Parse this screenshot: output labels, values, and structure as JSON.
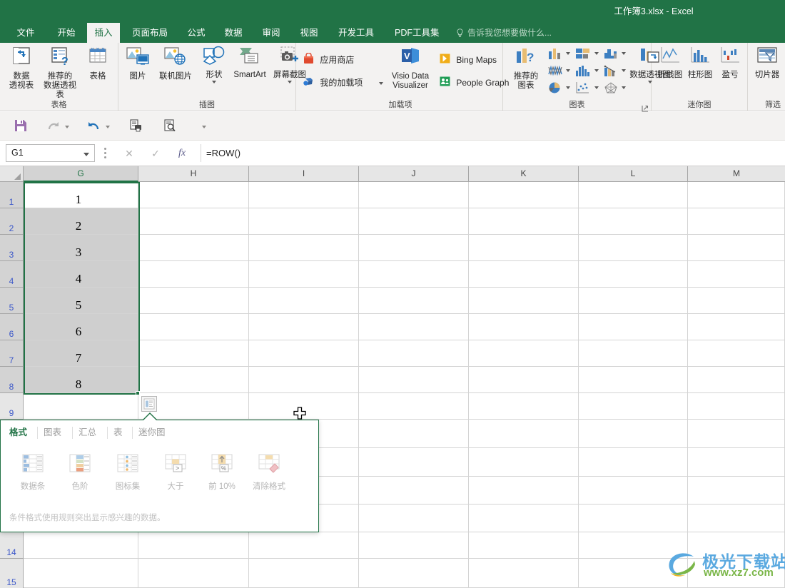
{
  "window": {
    "title": "工作簿3.xlsx - Excel"
  },
  "ribbon": {
    "tabs": [
      {
        "label": "文件",
        "active": false
      },
      {
        "label": "开始",
        "active": false
      },
      {
        "label": "插入",
        "active": true
      },
      {
        "label": "页面布局",
        "active": false
      },
      {
        "label": "公式",
        "active": false
      },
      {
        "label": "数据",
        "active": false
      },
      {
        "label": "审阅",
        "active": false
      },
      {
        "label": "视图",
        "active": false
      },
      {
        "label": "开发工具",
        "active": false
      },
      {
        "label": "PDF工具集",
        "active": false
      }
    ],
    "tell_me": "告诉我您想要做什么...",
    "groups": [
      {
        "name": "表格",
        "big_buttons": [
          {
            "label": "数据\n透视表",
            "icon": "pivot-table-icon"
          },
          {
            "label": "推荐的\n数据透视表",
            "icon": "recommended-pivot-table-icon"
          },
          {
            "label": "表格",
            "icon": "table-icon"
          }
        ]
      },
      {
        "name": "插图",
        "big_buttons": [
          {
            "label": "图片",
            "icon": "picture-icon"
          },
          {
            "label": "联机图片",
            "icon": "online-picture-icon"
          },
          {
            "label": "形状",
            "icon": "shapes-icon"
          },
          {
            "label": "SmartArt",
            "icon": "smartart-icon"
          },
          {
            "label": "屏幕截图",
            "icon": "screenshot-icon"
          }
        ]
      },
      {
        "name": "加载项",
        "small_buttons": [
          {
            "label": "应用商店",
            "icon": "store-icon"
          },
          {
            "label": "我的加载项",
            "icon": "my-addins-icon"
          },
          {
            "label": "Bing Maps",
            "icon": "bing-maps-icon"
          },
          {
            "label": "People Graph",
            "icon": "people-graph-icon"
          }
        ],
        "big_buttons": [
          {
            "label": "Visio Data\nVisualizer",
            "icon": "visio-data-visualizer-icon"
          }
        ]
      },
      {
        "name": "图表",
        "big_buttons": [
          {
            "label": "推荐的\n图表",
            "icon": "recommended-charts-icon"
          },
          {
            "label": "数据透视图",
            "icon": "pivot-chart-icon"
          }
        ],
        "mini_charts": [
          {
            "name": "column-chart-icon"
          },
          {
            "name": "bar-chart-icon"
          },
          {
            "name": "line-area-chart-icon"
          },
          {
            "name": "stock-chart-icon"
          },
          {
            "name": "histogram-chart-icon"
          },
          {
            "name": "waterfall-chart-icon"
          },
          {
            "name": "pie-chart-icon"
          },
          {
            "name": "scatter-chart-icon"
          },
          {
            "name": "radar-chart-icon"
          }
        ]
      },
      {
        "name": "迷你图",
        "big_buttons": [
          {
            "label": "折线图",
            "icon": "sparkline-line-icon"
          },
          {
            "label": "柱形图",
            "icon": "sparkline-column-icon"
          },
          {
            "label": "盈亏",
            "icon": "sparkline-winloss-icon"
          }
        ]
      },
      {
        "name": "筛选",
        "big_buttons": [
          {
            "label": "切片器",
            "icon": "slicer-icon"
          }
        ]
      }
    ]
  },
  "quick_access": {
    "buttons": [
      {
        "name": "save-icon"
      },
      {
        "name": "redo-icon"
      },
      {
        "name": "undo-icon"
      },
      {
        "name": "print-preview-icon"
      },
      {
        "name": "print-preview-and-print-icon"
      },
      {
        "name": "customize-qat-icon"
      }
    ]
  },
  "formula_bar": {
    "name_box_value": "G1",
    "cancel_label": "✕",
    "confirm_label": "✓",
    "fx_label": "fx",
    "formula_value": "=ROW()"
  },
  "grid": {
    "columns": [
      "G",
      "H",
      "I",
      "J",
      "K",
      "L",
      "M"
    ],
    "selected_column": "G",
    "rows": [
      "1",
      "2",
      "3",
      "4",
      "5",
      "6",
      "7",
      "8",
      "9",
      "14",
      "15"
    ],
    "selected_rows": [
      "1",
      "2",
      "3",
      "4",
      "5",
      "6",
      "7",
      "8"
    ],
    "column_g_values": [
      "1",
      "2",
      "3",
      "4",
      "5",
      "6",
      "7",
      "8"
    ],
    "active_cell": "G1",
    "selection_range": "G1:G8"
  },
  "quick_analysis": {
    "button_icon": "quick-analysis-icon",
    "tabs": [
      {
        "label": "格式",
        "active": true
      },
      {
        "label": "图表",
        "active": false
      },
      {
        "label": "汇总",
        "active": false
      },
      {
        "label": "表",
        "active": false
      },
      {
        "label": "迷你图",
        "active": false
      }
    ],
    "items": [
      {
        "label": "数据条",
        "icon": "data-bars-icon"
      },
      {
        "label": "色阶",
        "icon": "color-scale-icon"
      },
      {
        "label": "图标集",
        "icon": "icon-set-icon"
      },
      {
        "label": "大于",
        "icon": "greater-than-icon"
      },
      {
        "label": "前 10%",
        "icon": "top-ten-percent-icon"
      },
      {
        "label": "清除格式",
        "icon": "clear-format-icon"
      }
    ],
    "hint": "条件格式使用规则突出显示感兴趣的数据。"
  },
  "annotation": {
    "arrow_color": "#e8201a"
  },
  "watermark": {
    "line1": "极光下载站",
    "line2": "www.xz7.com"
  },
  "colors": {
    "brand_green": "#217346",
    "ribbon_bg": "#f3f2f1",
    "selection_fill": "#cfcfcf"
  }
}
